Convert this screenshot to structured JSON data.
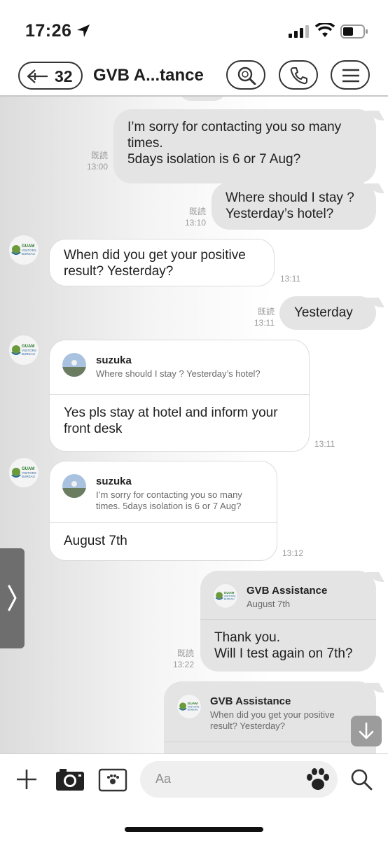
{
  "status_bar": {
    "time": "17:26"
  },
  "header": {
    "back_count": "32",
    "title": "GVB A...tance"
  },
  "avatar_text": {
    "line1": "GUAM",
    "line2": "VISITORS",
    "line3": "BUREAU"
  },
  "messages": [
    {
      "id": "m1",
      "direction": "out",
      "text": "I’m sorry for contacting you so many\ntimes.\n5days isolation is 6 or 7 Aug?",
      "read": "既読",
      "time": "13:00"
    },
    {
      "id": "m2",
      "direction": "out",
      "text": "Where should I stay ?\nYesterday’s hotel?",
      "read": "既読",
      "time": "13:10"
    },
    {
      "id": "m3",
      "direction": "in",
      "text": "When did you get your positive\nresult? Yesterday?",
      "time": "13:11"
    },
    {
      "id": "m4",
      "direction": "out",
      "text": "Yesterday",
      "read": "既読",
      "time": "13:11"
    },
    {
      "id": "m5",
      "direction": "in",
      "quote_name": "suzuka",
      "quote_text": "Where should I stay ? Yesterday’s hotel?",
      "text": "Yes pls stay at hotel and inform your\nfront desk",
      "time": "13:11"
    },
    {
      "id": "m6",
      "direction": "in",
      "quote_name": "suzuka",
      "quote_text": "I’m sorry for contacting you so many\ntimes. 5days isolation is 6 or 7 Aug?",
      "text": "August 7th",
      "time": "13:12"
    },
    {
      "id": "m7",
      "direction": "out",
      "quote_name": "GVB Assistance",
      "quote_text": "August 7th",
      "text": "Thank you.\nWill I test again on 7th?",
      "read": "既読",
      "time": "13:22"
    },
    {
      "id": "m8",
      "direction": "out",
      "quote_name": "GVB Assistance",
      "quote_text": "When did you get your positive\nresult? Yesterday?"
    }
  ],
  "input": {
    "placeholder": "Aa"
  },
  "icons": [
    "location-arrow-icon",
    "signal-icon",
    "wifi-icon",
    "battery-icon",
    "back-arrow-icon",
    "search-icon",
    "phone-icon",
    "menu-icon",
    "chevron-right-icon",
    "arrow-down-icon",
    "plus-icon",
    "camera-icon",
    "image-icon",
    "paw-icon",
    "search-icon"
  ],
  "colors": {
    "outgoing_bubble": "#e4e4e4",
    "incoming_bubble": "#ffffff",
    "meta_text": "#9a9a9a"
  }
}
